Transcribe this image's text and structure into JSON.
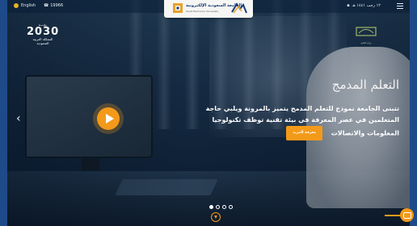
{
  "topbar": {
    "language_label": "English",
    "phone_number": "19966",
    "date_text": "١٢ رجب ١٤٤١ هـ"
  },
  "logo": {
    "arabic_name": "الجامعة السعودية الإلكترونية",
    "english_name": "Saudi Electronic University"
  },
  "vision": {
    "line1": "رؤيـــة",
    "year": "2030",
    "subtitle": "المملكة العربية السعودية"
  },
  "ministry": {
    "label": "وزارة التعليم"
  },
  "slide": {
    "headline": "التعلم المدمج",
    "description_line1": "تتبنى الجامعة نموذج للتعلم المدمج يتميز بالمرونة ويلبي حاجة",
    "description_line2": "المتعلمين في عصر المعرفة في بيئة تقنية توظف تكنولوجيا",
    "description_line3": "المعلومات والاتصالات",
    "more_button": "معرفة المزيد"
  },
  "carousel": {
    "slide_count": 4,
    "active_index": 0
  },
  "colors": {
    "accent": "#f49a1a",
    "brand_blue": "#1b3d78",
    "side_bar": "#1e4a8a"
  },
  "icons": {
    "prev": "chevron-left-icon",
    "next": "chevron-right-icon",
    "play": "play-icon",
    "scroll": "chevron-down-icon",
    "chat": "chat-icon",
    "menu": "menu-icon"
  }
}
